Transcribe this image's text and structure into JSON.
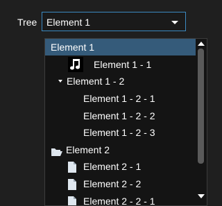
{
  "tree": {
    "label": "Tree",
    "selected_value": "Element 1"
  },
  "dropdown": {
    "items": [
      {
        "label": "Element 1",
        "selected": true,
        "icon": null
      },
      {
        "label": "Element 1 - 1",
        "icon": "music-note-icon"
      },
      {
        "label": "Element 1 - 2",
        "icon": "expand-caret-icon"
      },
      {
        "label": "Element 1 - 2 - 1",
        "icon": null
      },
      {
        "label": "Element 1 - 2 - 2",
        "icon": null
      },
      {
        "label": "Element 1 - 2 - 3",
        "icon": null
      },
      {
        "label": "Element 2",
        "icon": "folder-open-icon"
      },
      {
        "label": "Element 2 - 1",
        "icon": "file-icon"
      },
      {
        "label": "Element 2 - 2",
        "icon": "file-icon"
      },
      {
        "label": "Element 2 - 2 - 1",
        "icon": "file-icon"
      }
    ]
  },
  "colors": {
    "accent": "#3c8ac2",
    "selection": "#355b7a",
    "background": "#1f1f1f",
    "list_background": "#141414",
    "text": "#ffffff",
    "icon_fill": "#dfe7ef"
  }
}
